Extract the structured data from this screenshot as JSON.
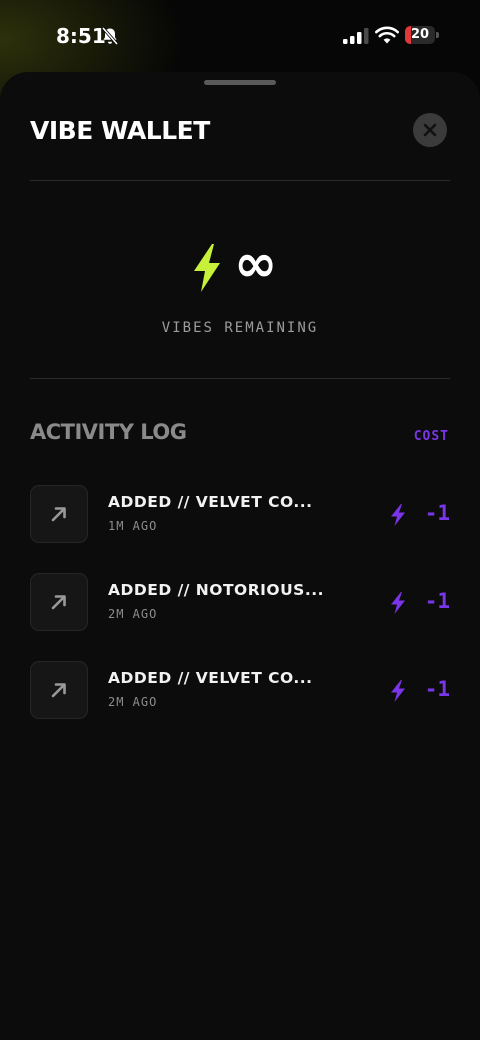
{
  "status_bar": {
    "time": "8:51",
    "battery_level": "20",
    "icons": [
      "bell-slash-icon",
      "cellular-signal-icon",
      "wifi-icon",
      "battery-icon"
    ]
  },
  "sheet": {
    "title": "VIBE WALLET",
    "close_icon": "close-icon"
  },
  "balance": {
    "value": "∞",
    "label": "VIBES REMAINING",
    "icon": "lightning-bolt-icon",
    "icon_color": "#c6f03a"
  },
  "activity": {
    "title": "ACTIVITY LOG",
    "cost_header": "COST",
    "accent_color": "#7a35e6",
    "items": [
      {
        "title": "ADDED // VELVET CO...",
        "time": "1M AGO",
        "cost": "-1",
        "icon": "arrow-up-right-icon"
      },
      {
        "title": "ADDED // NOTORIOUS...",
        "time": "2M AGO",
        "cost": "-1",
        "icon": "arrow-up-right-icon"
      },
      {
        "title": "ADDED // VELVET CO...",
        "time": "2M AGO",
        "cost": "-1",
        "icon": "arrow-up-right-icon"
      }
    ]
  }
}
